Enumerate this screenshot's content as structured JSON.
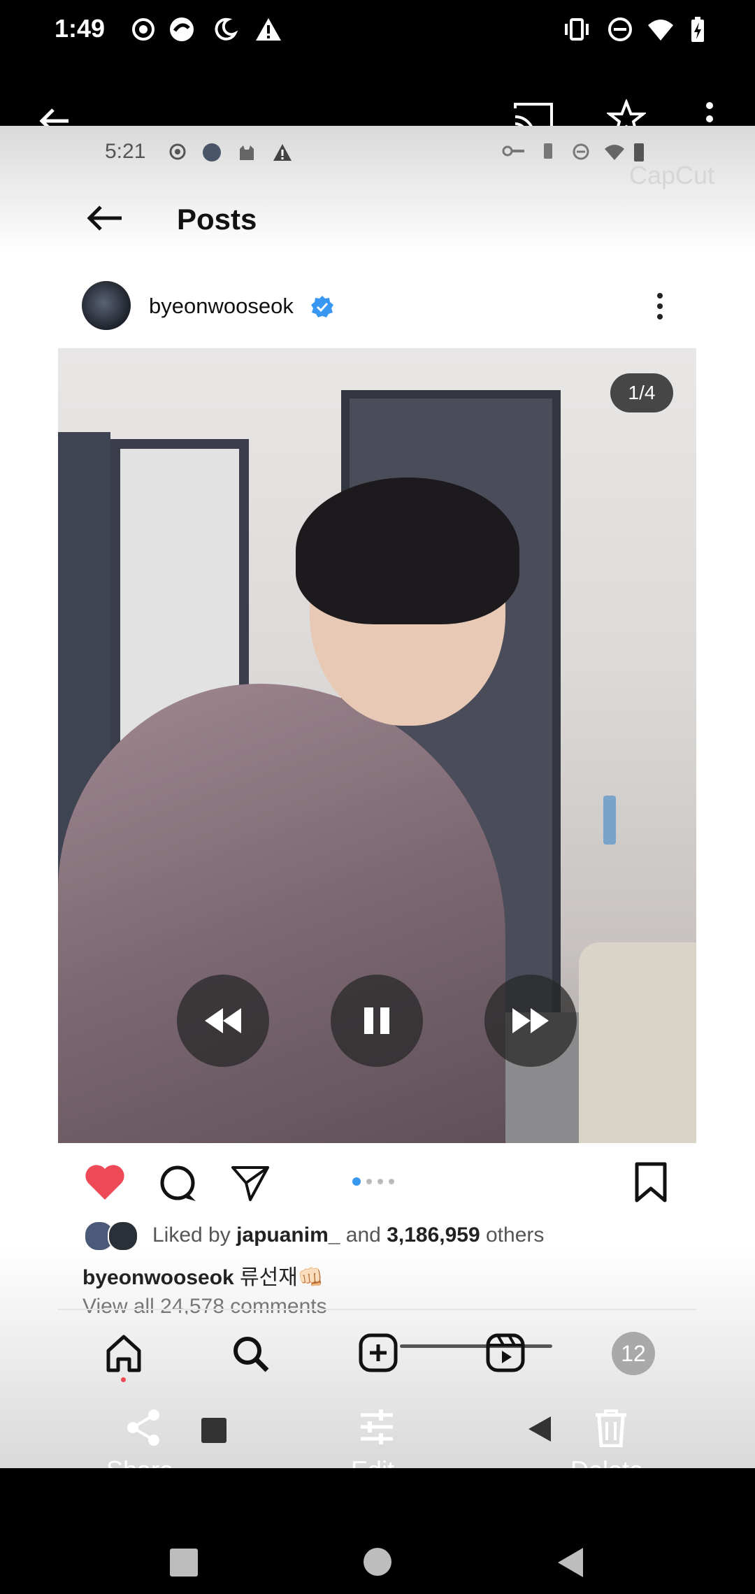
{
  "status_bar": {
    "time": "1:49"
  },
  "top_bar": {},
  "recording": {
    "status_time": "5:21",
    "watermark": "CapCut",
    "header_title": "Posts",
    "post": {
      "username": "byeonwooseok",
      "image_counter": "1/4",
      "likes_prefix": "Liked by ",
      "liked_by": "japuanim_",
      "likes_and": " and ",
      "likes_count": "3,186,959",
      "likes_suffix": " others",
      "caption_user": "byeonwooseok",
      "caption_text": " 류선재👊🏻",
      "comments_preview": "View all 24,578 comments"
    },
    "bottom_nav": {
      "profile_badge": "12"
    }
  },
  "actions": {
    "share_label": "Share",
    "edit_label": "Edit",
    "delete_label": "Delete"
  }
}
